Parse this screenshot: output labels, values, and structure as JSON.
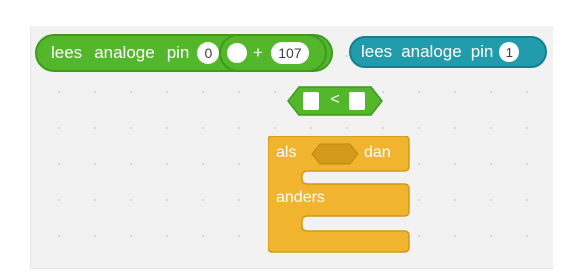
{
  "blocks": {
    "read_analog_green": {
      "words": [
        "lees",
        "analoge",
        "pin"
      ],
      "pin_value": "0",
      "operator": "+",
      "operand": "107",
      "color": "#52b72a"
    },
    "read_analog_teal": {
      "words": [
        "lees",
        "analoge",
        "pin"
      ],
      "pin_value": "1",
      "color": "#209cad"
    },
    "compare": {
      "operator": "<",
      "color": "#52b72a"
    },
    "if_else": {
      "if_label": "als",
      "then_label": "dan",
      "else_label": "anders",
      "color": "#f0b42e"
    }
  }
}
